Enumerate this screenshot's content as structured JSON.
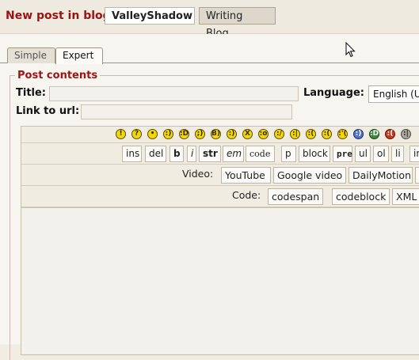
{
  "header": {
    "prefix": "New post in blog:",
    "blogs": [
      {
        "label": "ValleyShadow",
        "active": true
      },
      {
        "label": "Writing Blog",
        "active": false
      }
    ]
  },
  "tabs": [
    {
      "label": "Simple",
      "active": false
    },
    {
      "label": "Expert",
      "active": true
    }
  ],
  "form": {
    "legend": "Post contents",
    "title_label": "Title:",
    "title_value": "",
    "link_label": "Link to url:",
    "link_value": "",
    "language_label": "Language:",
    "language_value": "English (U"
  },
  "toolbar": {
    "smilies": [
      "!",
      "?",
      "•",
      ":)",
      ":D",
      ";)",
      "B)",
      ":)",
      "X",
      ":o",
      ":/",
      ":|",
      ":(",
      ":(",
      ":'(",
      ":)",
      ":D",
      ":(",
      ":|"
    ],
    "format": [
      "ins",
      "del",
      "b",
      "i",
      "str",
      "em",
      "code",
      "p",
      "block",
      "pre",
      "ul",
      "ol",
      "li",
      "in"
    ],
    "video_label": "Video:",
    "video": [
      "YouTube",
      "Google video",
      "DailyMotion"
    ],
    "code_label": "Code:",
    "code": [
      "codespan",
      "codeblock",
      "XML"
    ]
  }
}
